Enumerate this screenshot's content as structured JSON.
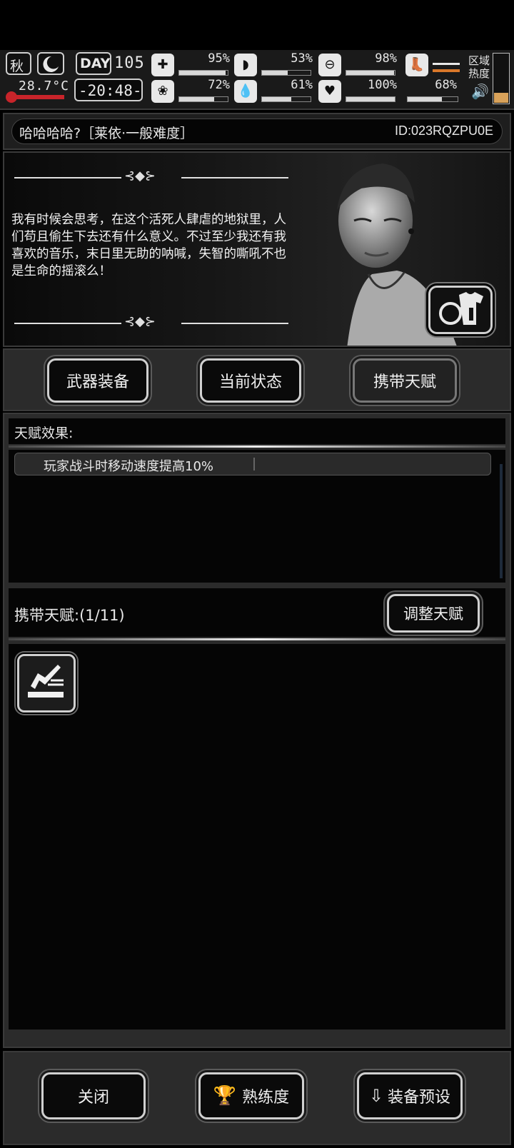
{
  "status": {
    "season": "秋",
    "temperature": "28.7°C",
    "day_label": "DAY",
    "day": "105",
    "clock": "-20:48-",
    "stats": [
      {
        "name": "health",
        "icon": "medkit-icon",
        "value": "95%",
        "level": 0.95
      },
      {
        "name": "stomach",
        "icon": "stomach-icon",
        "value": "53%",
        "level": 0.53
      },
      {
        "name": "energy",
        "icon": "pill-icon",
        "value": "98%",
        "level": 0.98
      },
      {
        "name": "brain",
        "icon": "brain-icon",
        "value": "72%",
        "level": 0.72
      },
      {
        "name": "water",
        "icon": "water-drop-icon",
        "value": "61%",
        "level": 0.61
      },
      {
        "name": "heart",
        "icon": "heart-icon",
        "value": "100%",
        "level": 1.0
      },
      {
        "name": "stamina",
        "icon": "boot-icon",
        "value": "68%",
        "level": 0.68
      }
    ],
    "zone_label_1": "区域",
    "zone_label_2": "热度"
  },
  "header": {
    "title": "哈哈哈哈?［莱依·一般难度］",
    "id": "ID:023RQZPU0E"
  },
  "character": {
    "quote": "我有时候会思考，在这个活死人肆虐的地狱里，人们苟且偷生下去还有什么意义。不过至少我还有我喜欢的音乐，末日里无助的呐喊，失智的嘶吼不也是生命的摇滚么！"
  },
  "tabs": [
    {
      "label": "武器装备"
    },
    {
      "label": "当前状态"
    },
    {
      "label": "携带天赋"
    }
  ],
  "talent_effects": {
    "header": "天赋效果:",
    "items": [
      "玩家战斗时移动速度提高10%"
    ]
  },
  "carried_talents": {
    "label": "携带天赋:(1/11)",
    "adjust_button": "调整天赋"
  },
  "footer": {
    "close": "关闭",
    "proficiency": "熟练度",
    "preset": "装备预设"
  }
}
